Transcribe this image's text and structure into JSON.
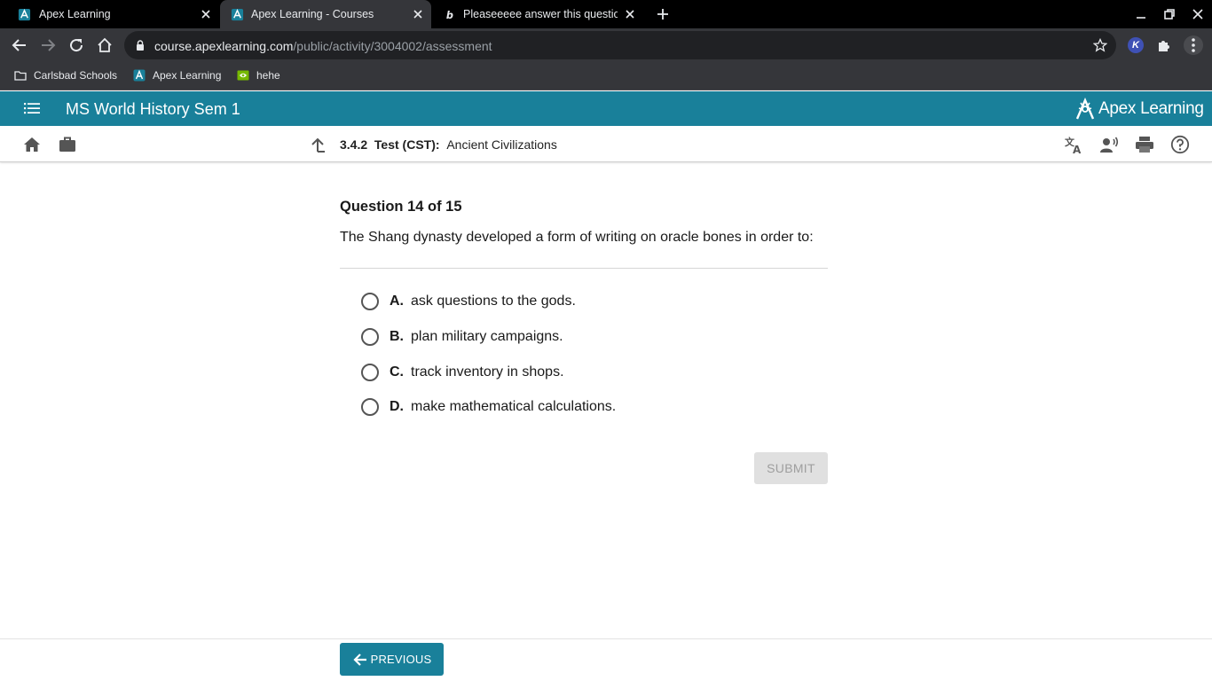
{
  "browser": {
    "tabs": [
      {
        "title": "Apex Learning",
        "icon": "apex-favicon",
        "active": false
      },
      {
        "title": "Apex Learning - Courses",
        "icon": "apex-favicon",
        "active": true
      },
      {
        "title": "Pleaseeeee answer this question",
        "icon": "brainly-favicon",
        "active": false
      }
    ],
    "url": {
      "host": "course.apexlearning.com",
      "path": "/public/activity/3004002/assessment"
    },
    "extension_badge": "K",
    "bookmarks": [
      {
        "label": "Carlsbad Schools",
        "icon": "folder-icon"
      },
      {
        "label": "Apex Learning",
        "icon": "apex-favicon"
      },
      {
        "label": "hehe",
        "icon": "nvidia-icon"
      }
    ]
  },
  "app": {
    "course_title": "MS World History Sem 1",
    "logo_text": "Apex Learning",
    "activity": {
      "number": "3.4.2",
      "type": "Test (CST):",
      "title": "Ancient Civilizations"
    }
  },
  "question": {
    "counter": "Question 14 of 15",
    "prompt": "The Shang dynasty developed a form of writing on oracle bones in order to:",
    "choices": [
      {
        "letter": "A.",
        "text": "ask questions to the gods.",
        "selected": false
      },
      {
        "letter": "B.",
        "text": "plan military campaigns.",
        "selected": false
      },
      {
        "letter": "C.",
        "text": "track inventory in shops.",
        "selected": false
      },
      {
        "letter": "D.",
        "text": "make mathematical calculations.",
        "selected": false
      }
    ],
    "submit_label": "SUBMIT",
    "submit_enabled": false
  },
  "footer": {
    "previous_label": "PREVIOUS"
  },
  "colors": {
    "brand_teal": "#19809a",
    "browser_dark": "#35363a",
    "omnibox": "#202124"
  }
}
